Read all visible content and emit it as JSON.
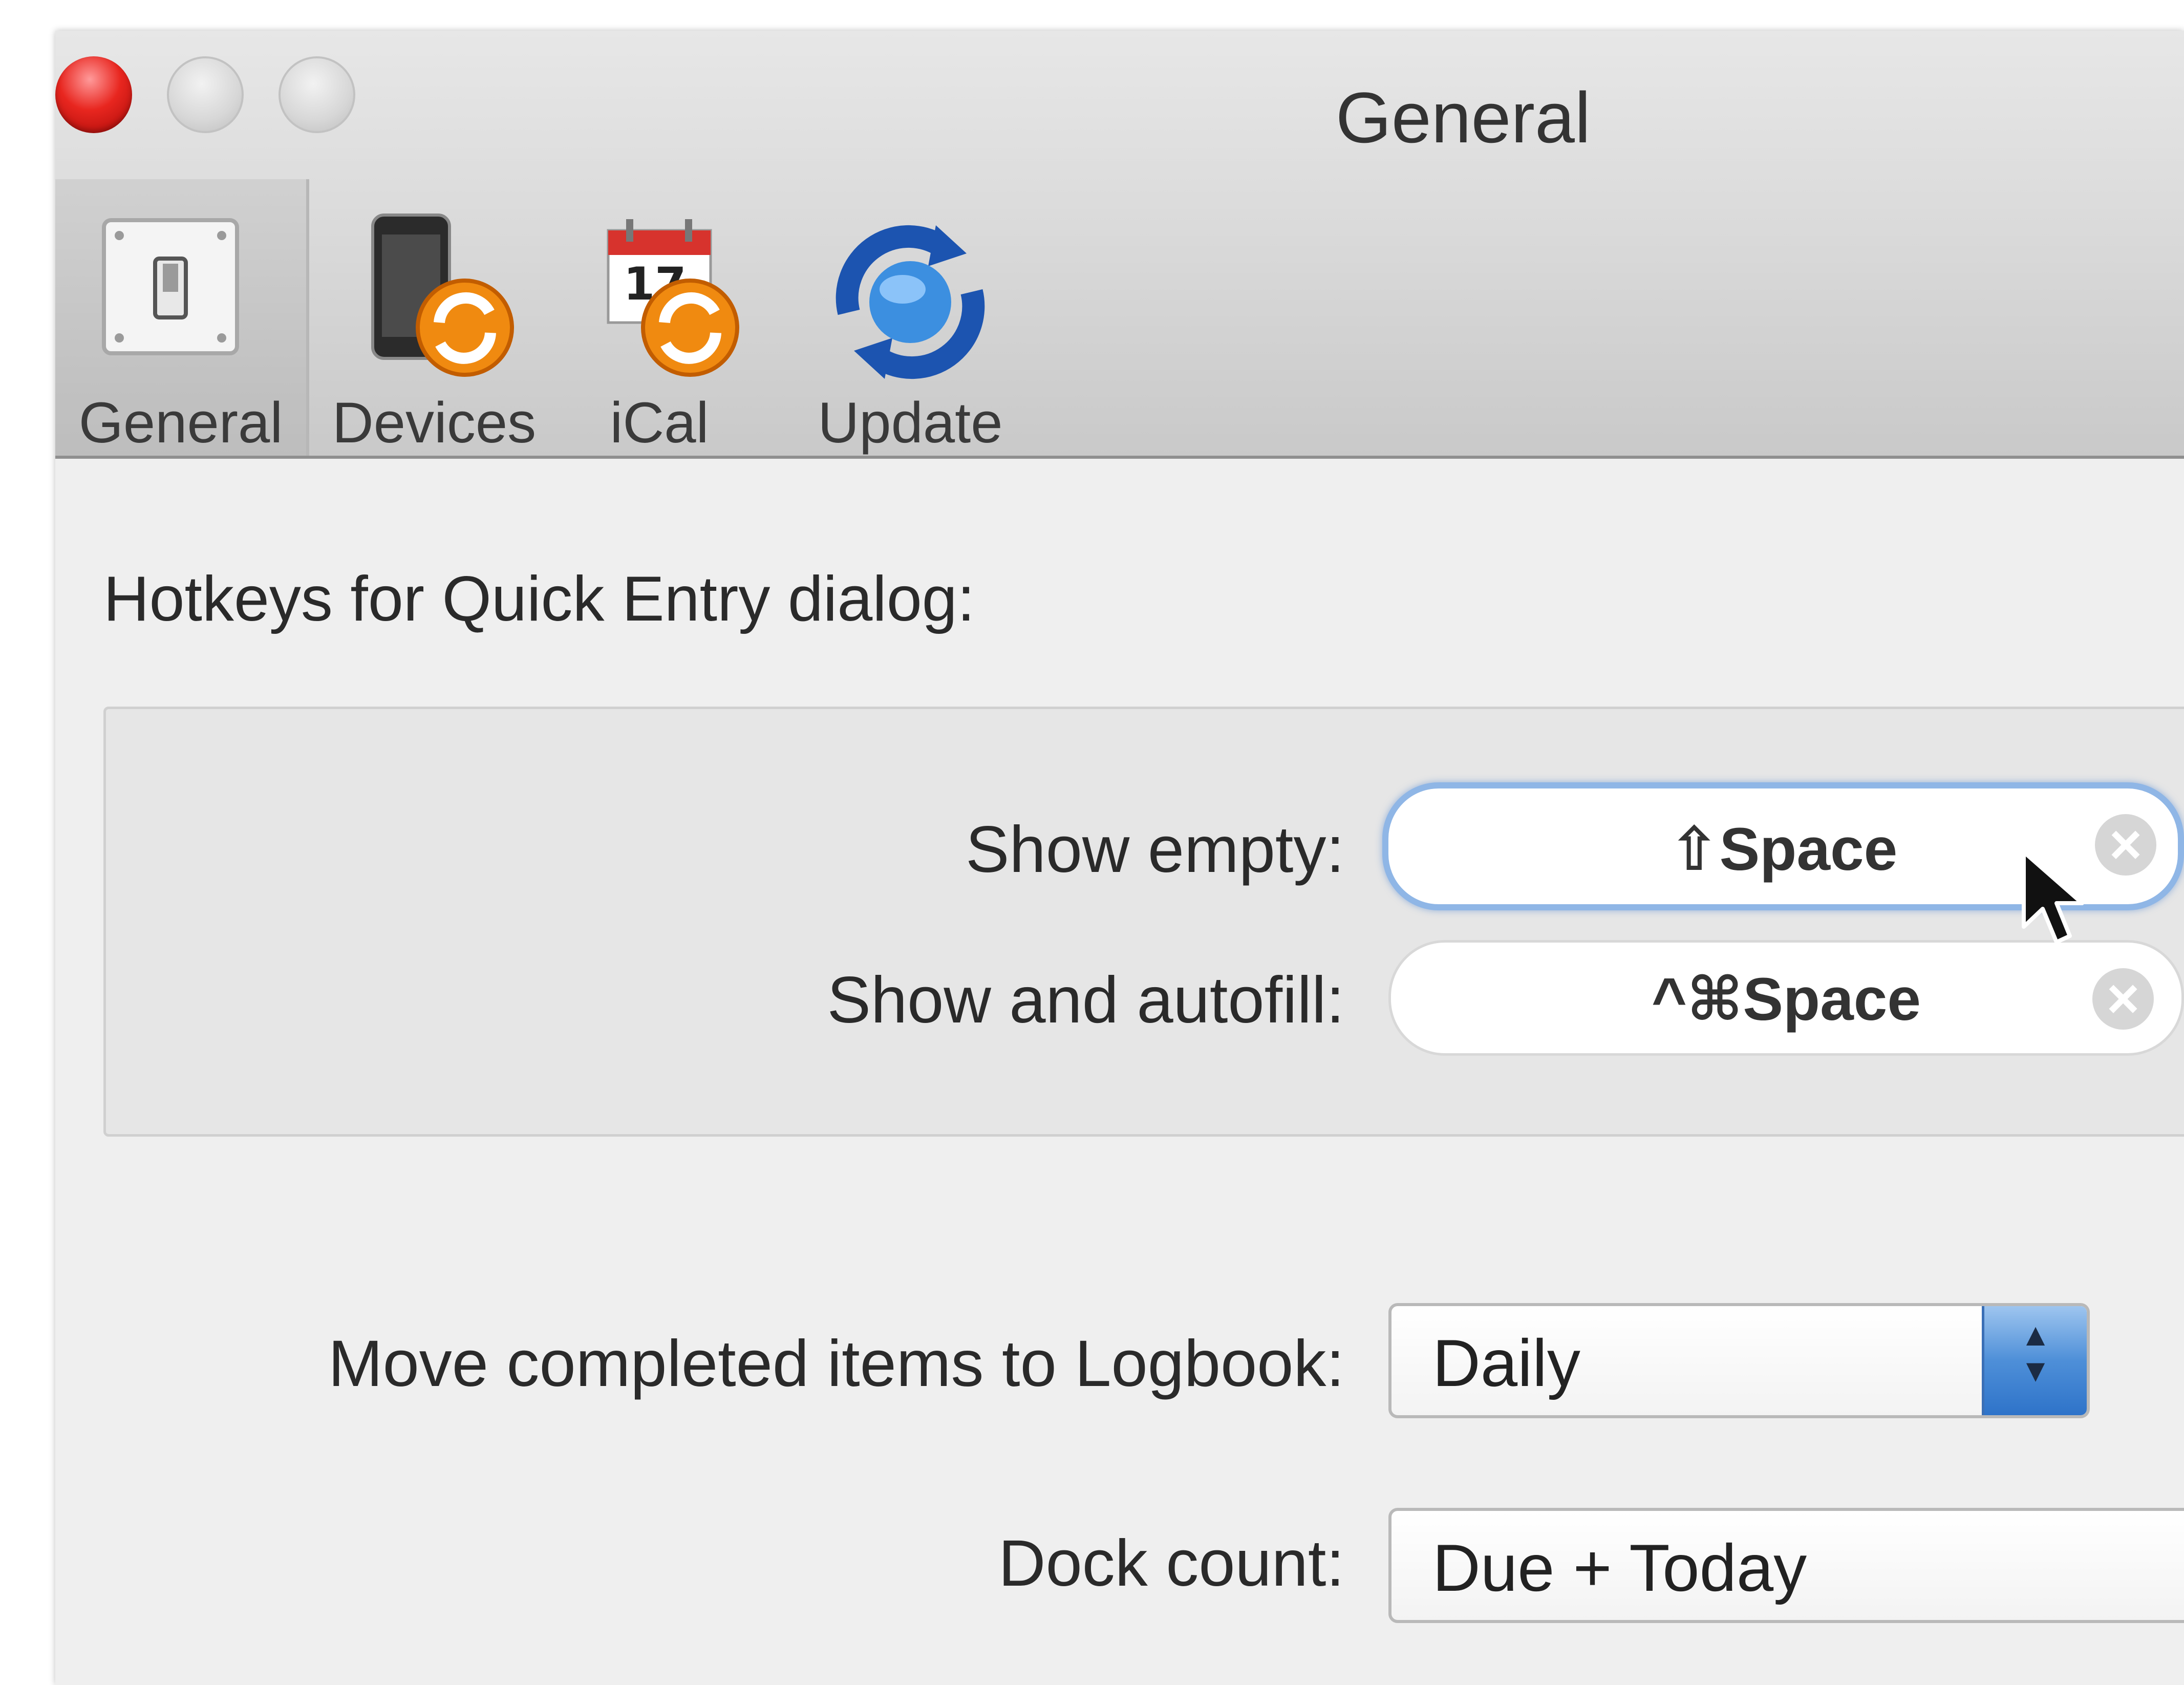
{
  "window": {
    "title": "General"
  },
  "toolbar": {
    "tabs": [
      {
        "label": "General",
        "icon": "switch-icon"
      },
      {
        "label": "Devices",
        "icon": "device-sync-icon"
      },
      {
        "label": "iCal",
        "icon": "calendar-sync-icon"
      },
      {
        "label": "Update",
        "icon": "update-globe-icon"
      }
    ],
    "calendar_day": "17",
    "selected": "General"
  },
  "hotkeys": {
    "section_title": "Hotkeys for Quick Entry dialog:",
    "show_empty": {
      "label": "Show empty:",
      "value": "⇧Space"
    },
    "show_autofill": {
      "label": "Show and autofill:",
      "value": "^⌘Space"
    }
  },
  "logbook": {
    "label": "Move completed items to Logbook:",
    "value": "Daily"
  },
  "dock": {
    "label": "Dock count:",
    "value": "Due + Today"
  },
  "colors": {
    "close": "#e8261f",
    "accent": "#4e8fd8",
    "focus": "#8fb6e6"
  }
}
